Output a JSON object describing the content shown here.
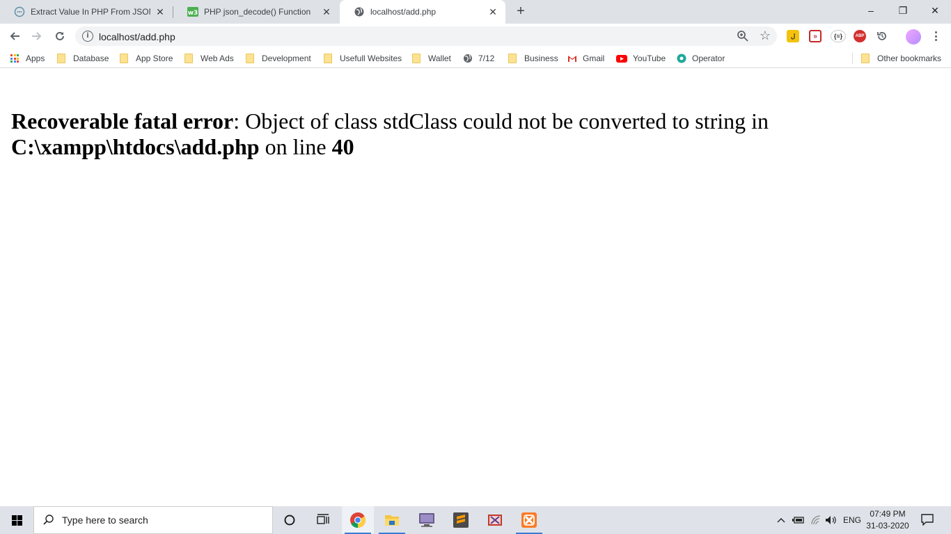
{
  "tabs": [
    {
      "title": "Extract Value In PHP From JSON A",
      "favicon": "chat-globe-icon"
    },
    {
      "title": "PHP json_decode() Function",
      "favicon": "w3schools-icon"
    },
    {
      "title": "localhost/add.php",
      "favicon": "globe-icon"
    }
  ],
  "window": {
    "new_tab": "+",
    "minimize": "–",
    "maximize": "❐",
    "close": "✕"
  },
  "address_bar": {
    "url": "localhost/add.php",
    "info_glyph": "i"
  },
  "bookmarks": {
    "apps": "Apps",
    "items": [
      "Database",
      "App Store",
      "Web Ads",
      "Development",
      "Usefull Websites",
      "Wallet",
      "7/12",
      "Business",
      "Gmail",
      "YouTube",
      "Operator"
    ],
    "other": "Other bookmarks"
  },
  "page": {
    "error_label": "Recoverable fatal error",
    "error_message": ": Object of class stdClass could not be converted to string in",
    "file_path": "C:\\xampp\\htdocs\\add.php",
    "on_line_text": " on line ",
    "line_number": "40"
  },
  "taskbar": {
    "search_placeholder": "Type here to search",
    "language": "ENG",
    "time": "07:49 PM",
    "date": "31-03-2020"
  },
  "colors": {
    "tabstrip": "#dee1e6",
    "folder": "#fde293",
    "youtube": "#ff0000",
    "gmail": "#d93025",
    "taskbar": "#dfe3e9"
  }
}
